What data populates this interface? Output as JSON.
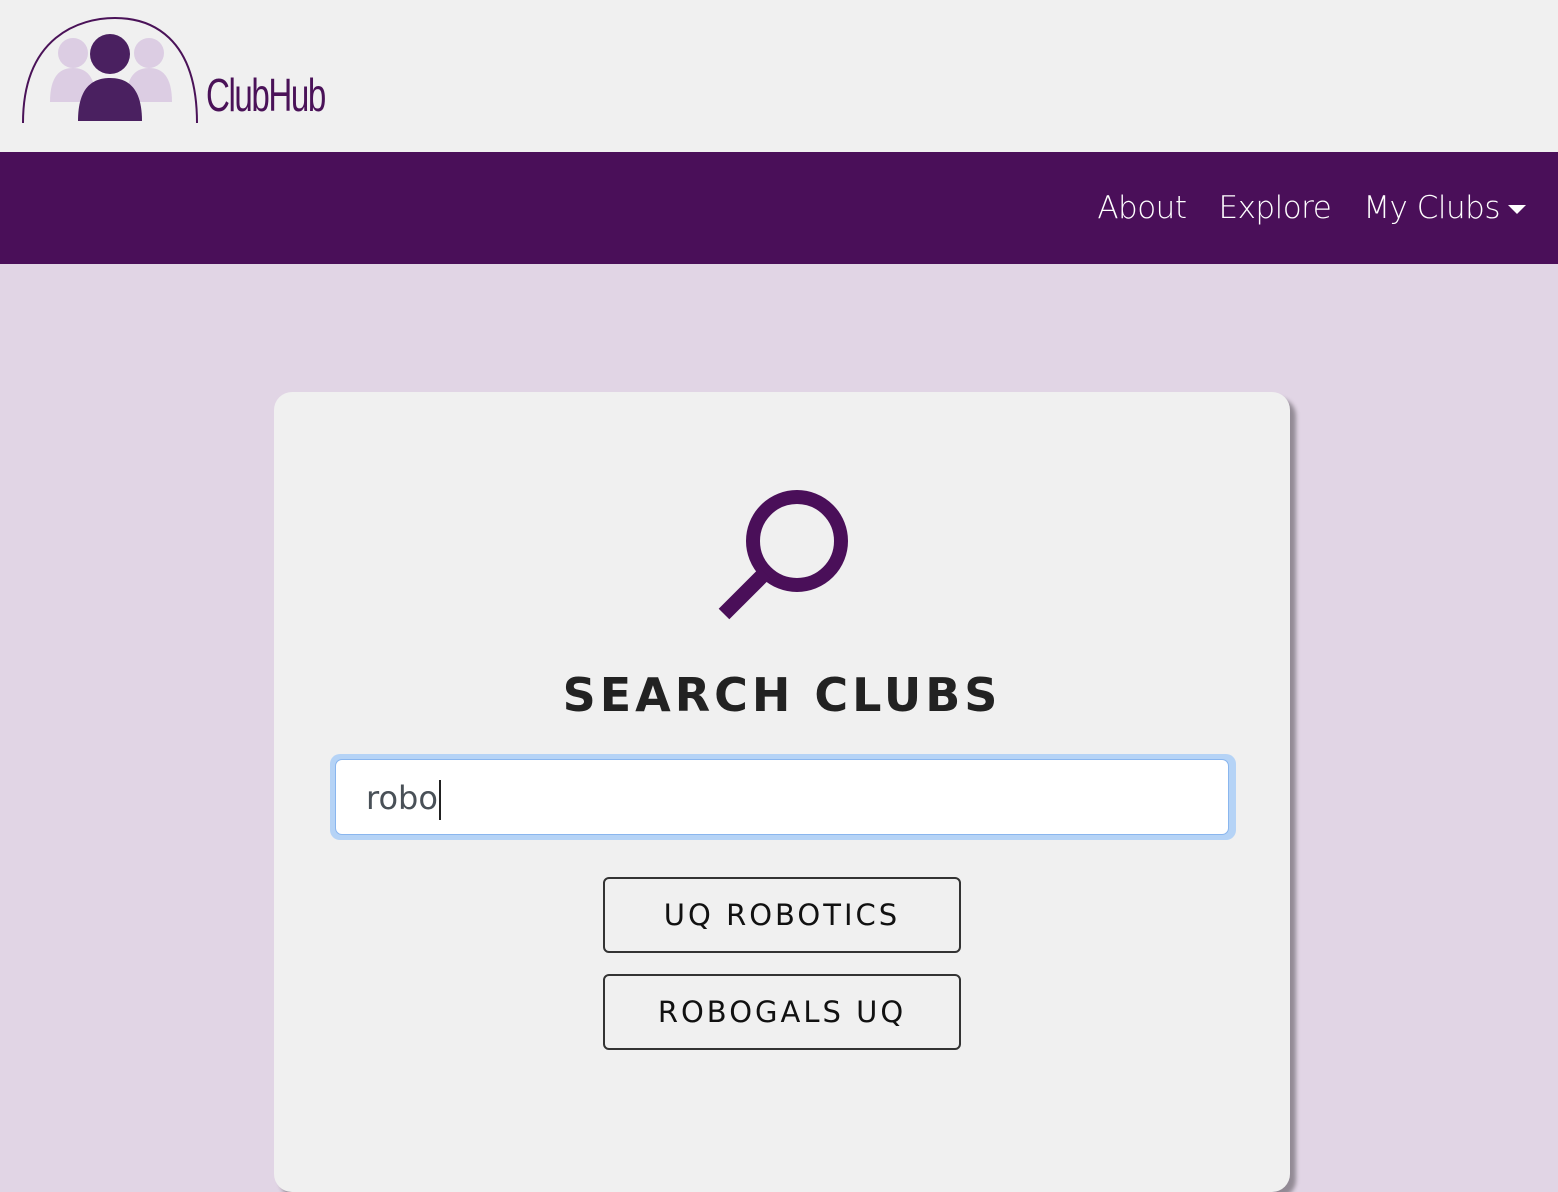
{
  "brand": {
    "name": "ClubHub",
    "color": "#4a1258"
  },
  "nav": {
    "background": "#4a0f59",
    "links": [
      {
        "label": "About"
      },
      {
        "label": "Explore"
      },
      {
        "label": "My Clubs",
        "has_dropdown": true
      }
    ]
  },
  "main": {
    "icon": "search-icon",
    "title": "SEARCH CLUBS",
    "search": {
      "value": "robo",
      "focused": true
    },
    "results": [
      {
        "label": "UQ ROBOTICS"
      },
      {
        "label": "ROBOGALS UQ"
      }
    ]
  },
  "colors": {
    "page_background": "#e1d5e5",
    "card_background": "#f0f0f0",
    "accent": "#4a0f59",
    "focus_ring": "#b5d3f6"
  }
}
